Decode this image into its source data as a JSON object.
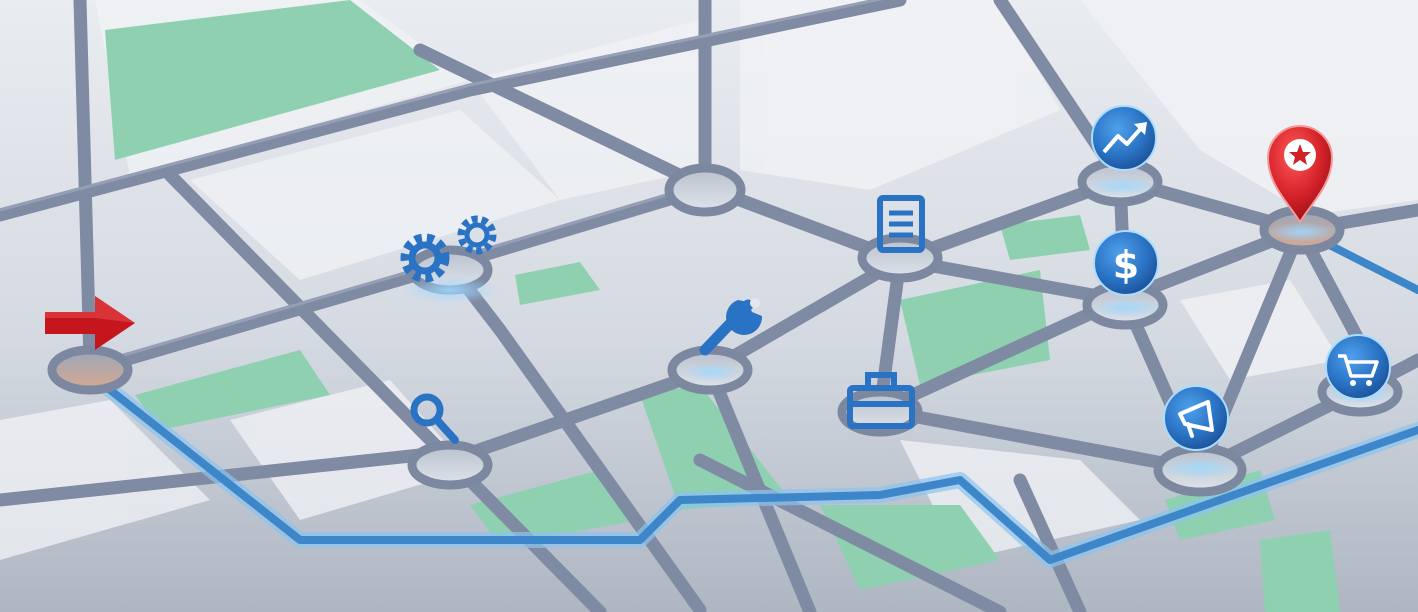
{
  "scene": {
    "description_free": true,
    "palette": {
      "ground_light": "#e9ecf0",
      "ground_dark": "#b4bbc6",
      "road": "#7f8aa3",
      "road_edge": "#9aa4b9",
      "park": "#8fd0b1",
      "route": "#3c86c9",
      "route_glow": "#8cc3ee",
      "node_ring": "#7c889f",
      "node_fill": "#c8ced8",
      "icon_blue": "#2a73c4",
      "icon_blue_dark": "#1b4f96",
      "pin_red": "#d32028",
      "arrow_red": "#c4161c"
    },
    "icons": [
      "start-arrow-icon",
      "gears-icon",
      "search-icon",
      "wrench-icon",
      "document-icon",
      "briefcase-icon",
      "trend-up-icon",
      "dollar-icon",
      "megaphone-icon",
      "cart-icon",
      "destination-pin-icon"
    ]
  }
}
